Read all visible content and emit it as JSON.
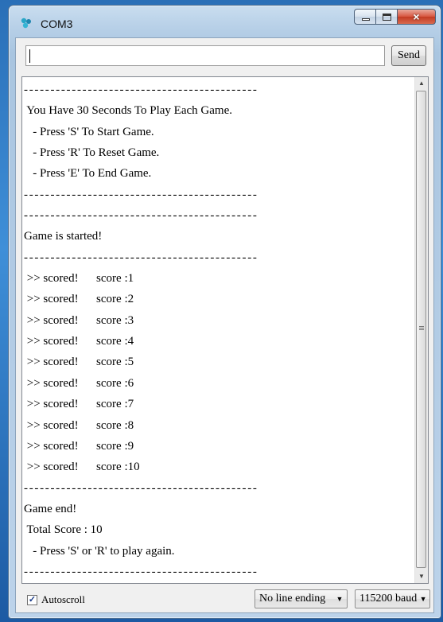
{
  "window": {
    "title": "COM3",
    "controls": {
      "minimize": "minimize",
      "maximize": "maximize",
      "close": "×"
    }
  },
  "input": {
    "value": "",
    "send_label": "Send"
  },
  "output": {
    "lines": [
      {
        "text": "--------------------------------------------",
        "kind": "dash"
      },
      {
        "text": " You Have 30 Seconds To Play Each Game.",
        "kind": "text"
      },
      {
        "text": "   - Press 'S' To Start Game.",
        "kind": "text"
      },
      {
        "text": "   - Press 'R' To Reset Game.",
        "kind": "text"
      },
      {
        "text": "   - Press 'E' To End Game.",
        "kind": "text"
      },
      {
        "text": "--------------------------------------------",
        "kind": "dash"
      },
      {
        "text": "--------------------------------------------",
        "kind": "dash"
      },
      {
        "text": "Game is started!",
        "kind": "text"
      },
      {
        "text": "--------------------------------------------",
        "kind": "dash"
      },
      {
        "text": " >> scored!      score :1",
        "kind": "text"
      },
      {
        "text": " >> scored!      score :2",
        "kind": "text"
      },
      {
        "text": " >> scored!      score :3",
        "kind": "text"
      },
      {
        "text": " >> scored!      score :4",
        "kind": "text"
      },
      {
        "text": " >> scored!      score :5",
        "kind": "text"
      },
      {
        "text": " >> scored!      score :6",
        "kind": "text"
      },
      {
        "text": " >> scored!      score :7",
        "kind": "text"
      },
      {
        "text": " >> scored!      score :8",
        "kind": "text"
      },
      {
        "text": " >> scored!      score :9",
        "kind": "text"
      },
      {
        "text": " >> scored!      score :10",
        "kind": "text"
      },
      {
        "text": "--------------------------------------------",
        "kind": "dash"
      },
      {
        "text": "Game end!",
        "kind": "text"
      },
      {
        "text": " Total Score : 10",
        "kind": "text"
      },
      {
        "text": "   - Press 'S' or 'R' to play again.",
        "kind": "text"
      },
      {
        "text": "--------------------------------------------",
        "kind": "dash"
      }
    ]
  },
  "footer": {
    "autoscroll_label": "Autoscroll",
    "autoscroll_checked": true,
    "line_ending": "No line ending",
    "baud": "115200 baud"
  },
  "colors": {
    "accent": "#3f8fd8",
    "close": "#c23a22"
  }
}
